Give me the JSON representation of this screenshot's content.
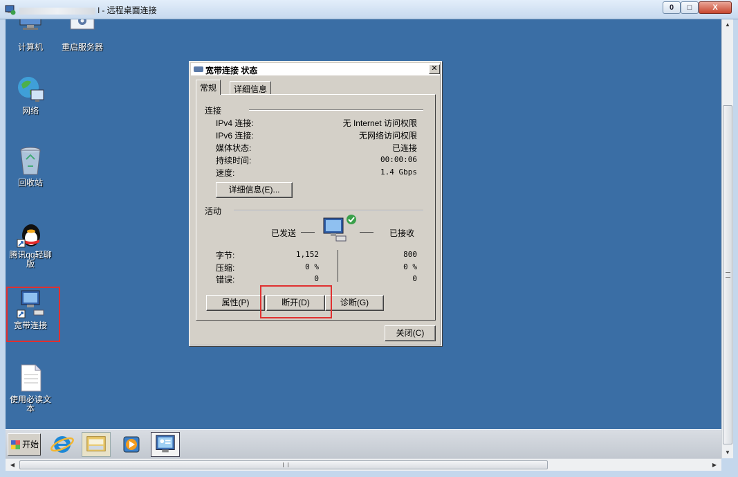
{
  "window": {
    "title_suffix": "l - 远程桌面连接",
    "min_glyph": "0",
    "max_glyph": "□",
    "close_glyph": "X"
  },
  "desktop_icons": {
    "computer": "计算机",
    "restart_server": "重启服务器",
    "network": "网络",
    "recycle_bin": "回收站",
    "qq": "腾讯qq轻聊版",
    "broadband": "宽带连接",
    "readme": "使用必读文本"
  },
  "dialog": {
    "title": "宽带连接 状态",
    "close_glyph": "✕",
    "tabs": [
      "常规",
      "详细信息"
    ],
    "connection_section": "连接",
    "rows": [
      {
        "label": "IPv4 连接:",
        "value": "无 Internet 访问权限"
      },
      {
        "label": "IPv6 连接:",
        "value": "无网络访问权限"
      },
      {
        "label": "媒体状态:",
        "value": "已连接"
      },
      {
        "label": "持续时间:",
        "value": "00:00:06"
      },
      {
        "label": "速度:",
        "value": "1.4 Gbps"
      }
    ],
    "details_button": "详细信息(E)...",
    "activity_section": "活动",
    "sent_label": "已发送",
    "received_label": "已接收",
    "stats": [
      {
        "label": "字节:",
        "sent": "1,152",
        "received": "800"
      },
      {
        "label": "压缩:",
        "sent": "0 %",
        "received": "0 %"
      },
      {
        "label": "错误:",
        "sent": "0",
        "received": "0"
      }
    ],
    "properties_button": "属性(P)",
    "disconnect_button": "断开(D)",
    "diagnose_button": "诊断(G)",
    "close_button": "关闭(C)"
  },
  "taskbar": {
    "start_label": "开始"
  },
  "scroll": {
    "arrow_up": "▲",
    "arrow_down": "▼",
    "arrow_left": "◀",
    "arrow_right": "▶"
  }
}
